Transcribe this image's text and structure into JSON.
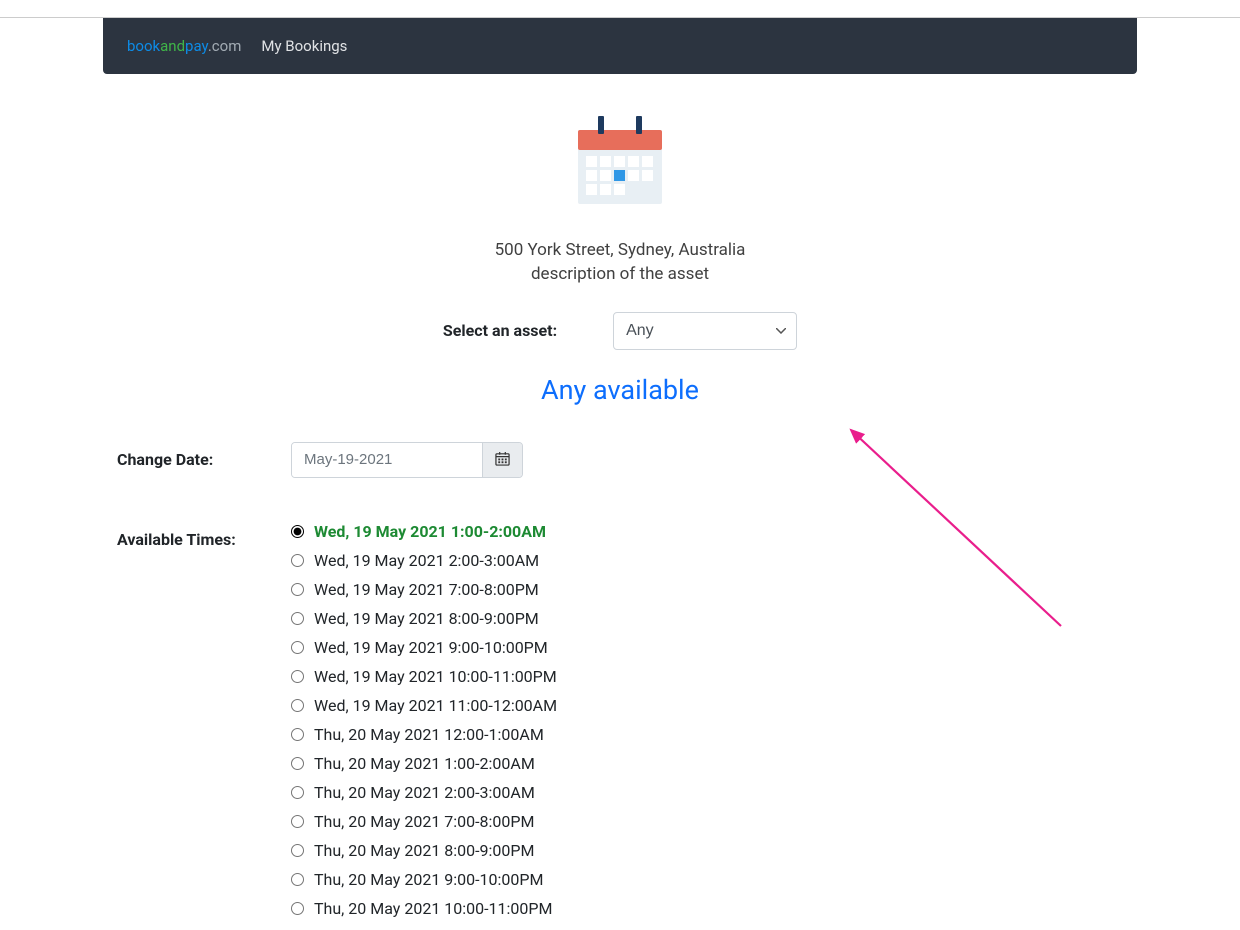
{
  "nav": {
    "brand": {
      "part1": "book",
      "part2": "and",
      "part3": "pay",
      "part4": ".com"
    },
    "my_bookings": "My Bookings"
  },
  "header": {
    "address": "500 York Street, Sydney, Australia",
    "description": "description of the asset"
  },
  "asset_selector": {
    "label": "Select an asset:",
    "value": "Any"
  },
  "subtitle": "Any available",
  "date": {
    "label": "Change Date:",
    "value": "May-19-2021"
  },
  "times": {
    "label": "Available Times:",
    "options": [
      {
        "label": "Wed, 19 May 2021 1:00-2:00AM",
        "selected": true
      },
      {
        "label": "Wed, 19 May 2021 2:00-3:00AM",
        "selected": false
      },
      {
        "label": "Wed, 19 May 2021 7:00-8:00PM",
        "selected": false
      },
      {
        "label": "Wed, 19 May 2021 8:00-9:00PM",
        "selected": false
      },
      {
        "label": "Wed, 19 May 2021 9:00-10:00PM",
        "selected": false
      },
      {
        "label": "Wed, 19 May 2021 10:00-11:00PM",
        "selected": false
      },
      {
        "label": "Wed, 19 May 2021 11:00-12:00AM",
        "selected": false
      },
      {
        "label": "Thu, 20 May 2021 12:00-1:00AM",
        "selected": false
      },
      {
        "label": "Thu, 20 May 2021 1:00-2:00AM",
        "selected": false
      },
      {
        "label": "Thu, 20 May 2021 2:00-3:00AM",
        "selected": false
      },
      {
        "label": "Thu, 20 May 2021 7:00-8:00PM",
        "selected": false
      },
      {
        "label": "Thu, 20 May 2021 8:00-9:00PM",
        "selected": false
      },
      {
        "label": "Thu, 20 May 2021 9:00-10:00PM",
        "selected": false
      },
      {
        "label": "Thu, 20 May 2021 10:00-11:00PM",
        "selected": false
      }
    ]
  }
}
